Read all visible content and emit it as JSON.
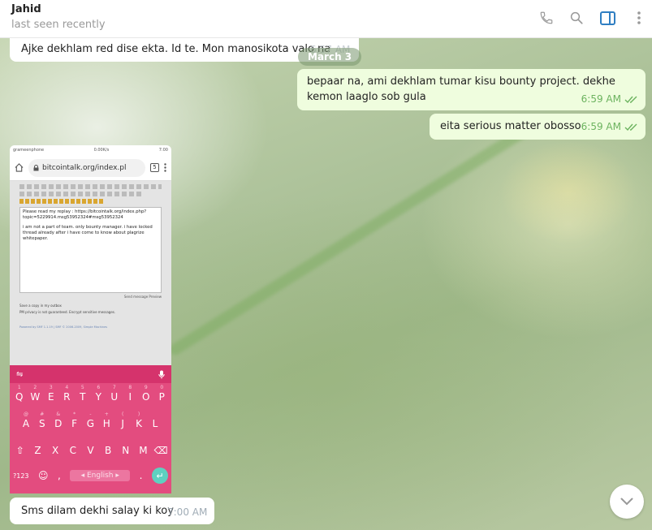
{
  "header": {
    "peer_name": "Jahid",
    "peer_status": "last seen recently",
    "icons": [
      "phone-icon",
      "search-icon",
      "sidebar-toggle-icon",
      "more-vertical-icon"
    ],
    "accent_color": "#2f7ec2"
  },
  "chat": {
    "date_separator": "March 3",
    "messages": [
      {
        "direction": "in",
        "text": "Ajke dekhlam red dise ekta. Id te. Mon manosikota valo na",
        "time": "6:57 AM"
      },
      {
        "direction": "out",
        "text": "bepaar na, ami dekhlam tumar kisu bounty project. dekhe kemon laaglo sob gula",
        "time": "6:59 AM"
      },
      {
        "direction": "out",
        "text": "eita serious matter obosso",
        "time": "6:59 AM"
      },
      {
        "direction": "in",
        "text": "Sms dilam dekhi salay ki koy",
        "time": "7:00 AM"
      }
    ],
    "outgoing_bubble_color": "#effdde",
    "read_tick_color": "#6cb35f"
  },
  "photo": {
    "status_left": "grameenphone",
    "status_speed": "0.00K/s",
    "status_time": "7:00",
    "url": "bitcointalk.org/index.pl",
    "tab_count": "5",
    "reply_line1": "Please read my replay : https://bitcointalk.org/index.php?topic=5229914.msg53952324#msg53952324",
    "reply_line2": "i am not a part of team. only bounty manager. i have locked thread already after i have come to know about plagrize whitepaper.",
    "buttons": "Send message    Preview",
    "checkbox_label": "Save a copy in my outbox",
    "privacy_note": "PM privacy is not guaranteed. Encrypt sensitive messages.",
    "footer_note": "Powered by SMF 1.1.19 | SMF © 2006-2009, Simple Machines",
    "keyboard": {
      "row1": [
        "Q",
        "W",
        "E",
        "R",
        "T",
        "Y",
        "U",
        "I",
        "O",
        "P"
      ],
      "row1_hints": [
        "1",
        "2",
        "3",
        "4",
        "5",
        "6",
        "7",
        "8",
        "9",
        "0"
      ],
      "row2": [
        "A",
        "S",
        "D",
        "F",
        "G",
        "H",
        "J",
        "K",
        "L"
      ],
      "row2_hints": [
        "@",
        "#",
        "&",
        "*",
        "-",
        "+",
        "(",
        ")",
        ""
      ],
      "row3": [
        "Z",
        "X",
        "C",
        "V",
        "B",
        "N",
        "M"
      ],
      "row3_hints": [
        "",
        "",
        "",
        "",
        "",
        "",
        ""
      ],
      "symbols_key": "?123",
      "space_label": "English",
      "color": "#e34c7f"
    }
  }
}
